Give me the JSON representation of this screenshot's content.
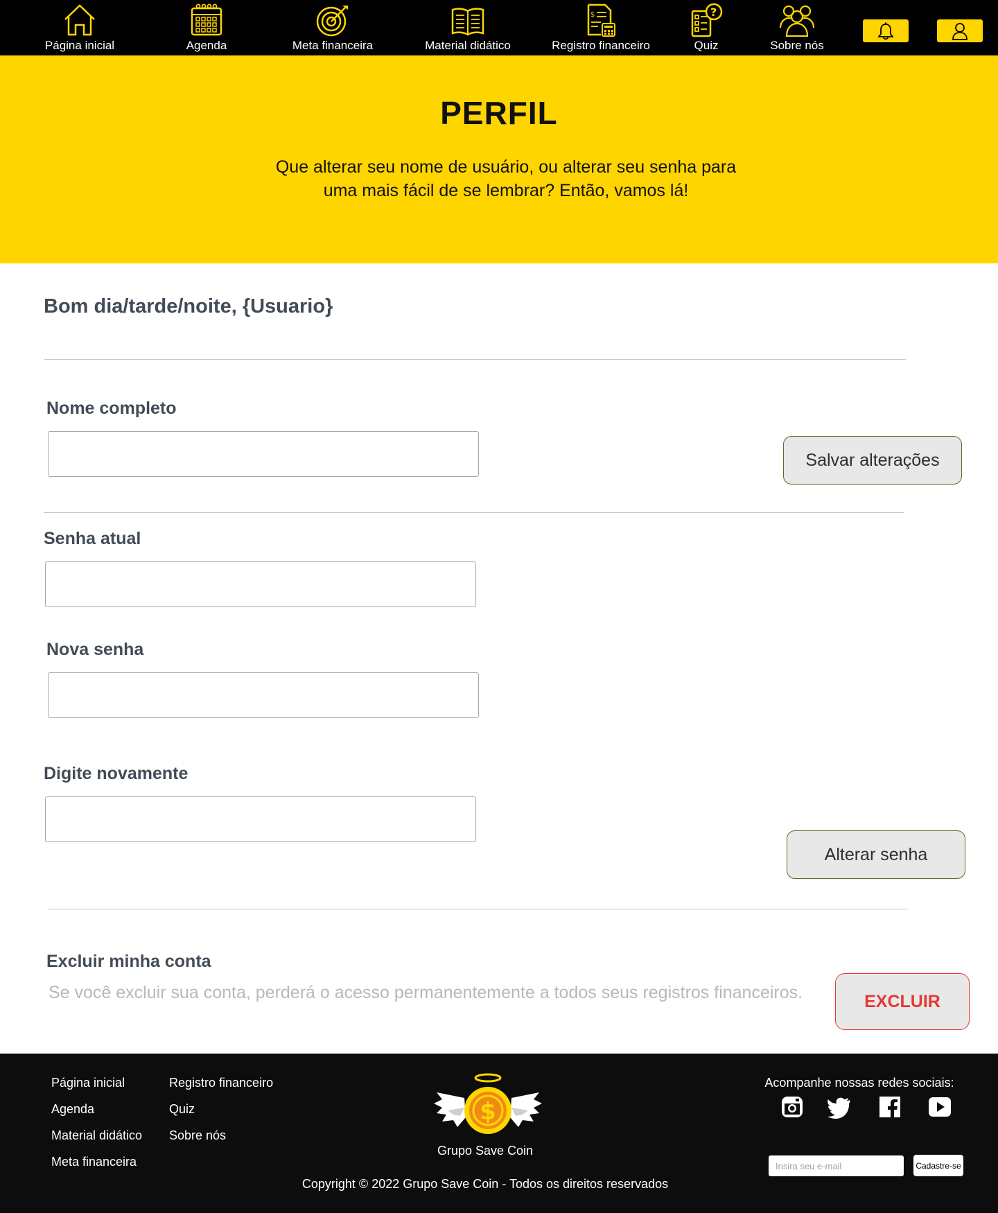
{
  "nav": {
    "items": [
      {
        "label": "Página inicial",
        "icon": "home-icon"
      },
      {
        "label": "Agenda",
        "icon": "calendar-icon"
      },
      {
        "label": "Meta financeira",
        "icon": "target-icon"
      },
      {
        "label": "Material didático",
        "icon": "book-icon"
      },
      {
        "label": "Registro financeiro",
        "icon": "financial-record-icon"
      },
      {
        "label": "Quiz",
        "icon": "quiz-icon"
      },
      {
        "label": "Sobre nós",
        "icon": "team-icon"
      }
    ],
    "notification_icon": "bell-icon",
    "profile_icon": "user-icon",
    "icon_color": "#ffd500"
  },
  "hero": {
    "title": "PERFIL",
    "subtitle": "Que alterar seu nome de usuário, ou alterar seu senha para uma mais fácil de se lembrar? Então, vamos lá!",
    "background": "#ffd500"
  },
  "profile": {
    "greeting": "Bom dia/tarde/noite, {Usuario}",
    "full_name_label": "Nome completo",
    "full_name_value": "",
    "save_button": "Salvar alterações",
    "current_password_label": "Senha atual",
    "new_password_label": "Nova senha",
    "repeat_password_label": "Digite novamente",
    "change_password_button": "Alterar senha",
    "delete_title": "Excluir minha conta",
    "delete_description": "Se você excluir sua conta, perderá o acesso permanentemente a todos seus registros financeiros.",
    "delete_button": "EXCLUIR",
    "danger_color": "#e53935"
  },
  "footer": {
    "links_col1": [
      "Página inicial",
      "Agenda",
      "Material didático",
      "Meta financeira"
    ],
    "links_col2": [
      "Registro financeiro",
      "Quiz",
      "Sobre nós"
    ],
    "brand": "Grupo Save Coin",
    "logo_icon": "winged-coin-logo",
    "copyright": "Copyright © 2022 Grupo Save Coin - Todos os direitos reservados",
    "social_title": "Acompanhe nossas redes sociais:",
    "social_icons": [
      "instagram-icon",
      "twitter-icon",
      "facebook-icon",
      "youtube-icon"
    ],
    "email_placeholder": "Insira seu e-mail",
    "subscribe_button": "Cadastre-se"
  }
}
